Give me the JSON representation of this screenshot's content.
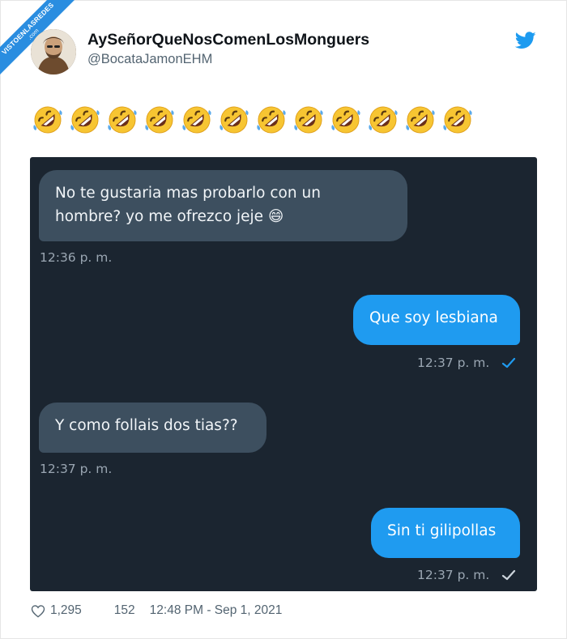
{
  "watermark": {
    "name": "VISTOENLASREDES",
    "sub": ".com"
  },
  "tweet": {
    "display_name": "AySeñorQueNosComenLosMonguers",
    "handle": "@BocataJamonEHM",
    "emoji_count": 12,
    "emoji_name": "rolling-on-floor-laughing"
  },
  "chat": {
    "messages": [
      {
        "direction": "in",
        "text_line1": "No te gustaria mas probarlo con un",
        "text_line2": "hombre? yo me ofrezco jeje 😄",
        "time": "12:36 p. m."
      },
      {
        "direction": "out",
        "text": "Que soy lesbiana",
        "time": "12:37 p. m.",
        "check_color": "#1f9bf0"
      },
      {
        "direction": "in",
        "text": "Y como follais dos tias??",
        "time": "12:37 p. m."
      },
      {
        "direction": "out",
        "text": "Sin ti gilipollas",
        "time": "12:37 p. m.",
        "check_color": "#cdd5dc"
      }
    ]
  },
  "footer": {
    "likes": "1,295",
    "retweets": "152",
    "timestamp": "12:48 PM - Sep 1, 2021"
  },
  "colors": {
    "twitter_blue": "#1d9bf0",
    "chat_bg": "#1b2530",
    "incoming_bubble": "#3d4f5f",
    "outgoing_bubble": "#1f9bf0"
  }
}
